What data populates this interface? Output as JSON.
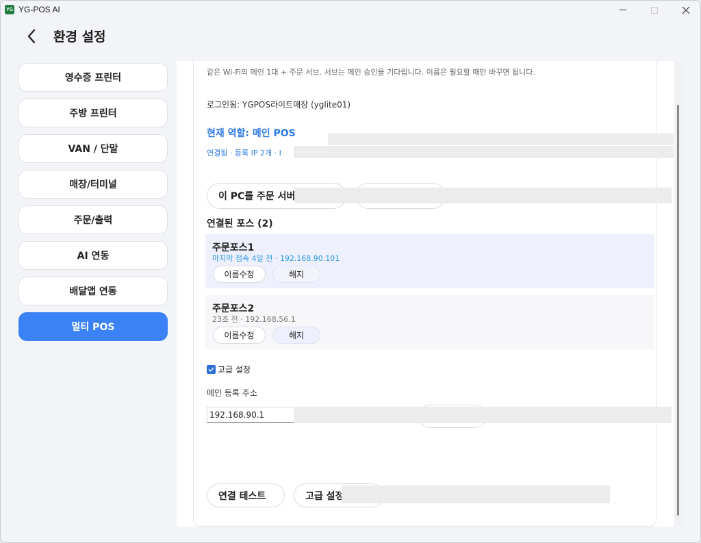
{
  "app": {
    "logo_text": "YG",
    "title": "YG-POS AI"
  },
  "header": {
    "title": "환경 설정"
  },
  "sidebar": {
    "items": [
      {
        "label": "영수증 프린터"
      },
      {
        "label": "주방 프린터"
      },
      {
        "label": "VAN / 단말"
      },
      {
        "label": "매장/터미널"
      },
      {
        "label": "주문/출력"
      },
      {
        "label": "AI 연동"
      },
      {
        "label": "배달앱 연동"
      },
      {
        "label": "멀티 POS",
        "active": true
      }
    ]
  },
  "content": {
    "description": "같은 Wi-Fi의 메인 1대 + 주문 서브. 서브는 메인 승인을 기다립니다. 이름은 필요할 때만 바꾸면 됩니다.",
    "login_status": "로그인됨: YGPOS라이트매장 (yglite01)",
    "role": "현재 역할: 메인 POS",
    "connection": "연결됨 · 등록 IP 2개 · I",
    "set_order_server_button": "이 PC를 주문 서버",
    "connected_title": "연결된 포스 (2)",
    "connected_pos": [
      {
        "name": "주문포스1",
        "meta": "마지막 접속 4일 전 · 192.168.90.101",
        "rename": "이름수정",
        "unlink": "해지"
      },
      {
        "name": "주문포스2",
        "meta": "23초 전 · 192.168.56.1",
        "rename": "이름수정",
        "unlink": "해지"
      }
    ],
    "advanced_label": "고급 설정",
    "advanced_checked": true,
    "main_address_label": "메인 등록 주소",
    "main_address_value": "192.168.90.1",
    "test_button": "연결 테스트",
    "advanced_button": "고급 설정"
  },
  "colors": {
    "accent": "#3b82f6",
    "link": "#2f7be5"
  }
}
